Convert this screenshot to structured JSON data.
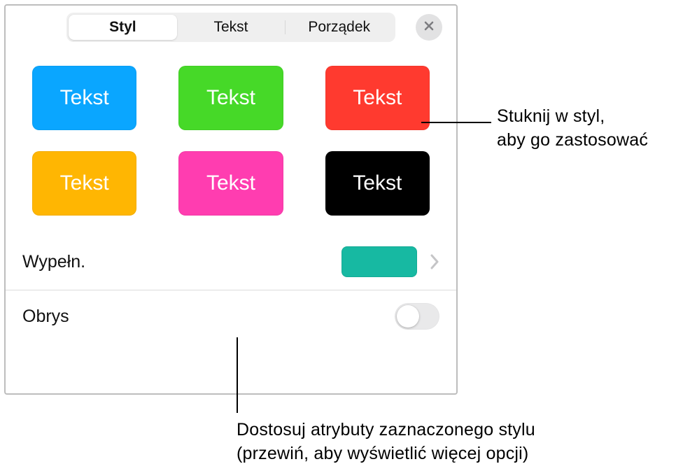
{
  "tabs": {
    "style": "Styl",
    "text": "Tekst",
    "arrange": "Porządek"
  },
  "swatches": {
    "label": "Tekst",
    "colors": [
      "#0aa6ff",
      "#46d928",
      "#ff3a2f",
      "#ffb602",
      "#ff3db0",
      "#000000"
    ]
  },
  "fill": {
    "label": "Wypełn.",
    "color": "#17b9a2"
  },
  "border": {
    "label": "Obrys"
  },
  "callouts": {
    "style": "Stuknij w styl,\naby go zastosować",
    "attrs": "Dostosuj atrybuty zaznaczonego stylu\n(przewiń, aby wyświetlić więcej opcji)"
  }
}
